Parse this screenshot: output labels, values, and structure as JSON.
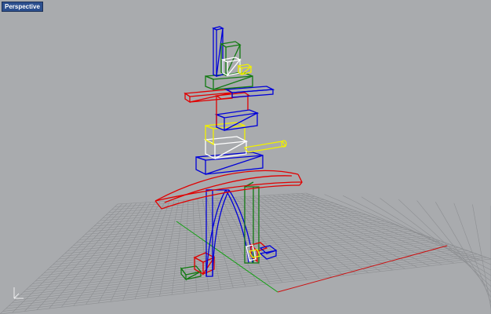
{
  "viewport": {
    "title": "Perspective"
  },
  "colors": {
    "background": "#a9abae",
    "grid": "#8f9194",
    "axis_x": "#cc1010",
    "axis_y": "#10a010",
    "blue": "#0000d8",
    "red": "#e00000",
    "green": "#127a12",
    "yellow": "#f0f000",
    "white": "#ffffff"
  },
  "gizmo": {
    "icon": "axis-gizmo-icon"
  }
}
